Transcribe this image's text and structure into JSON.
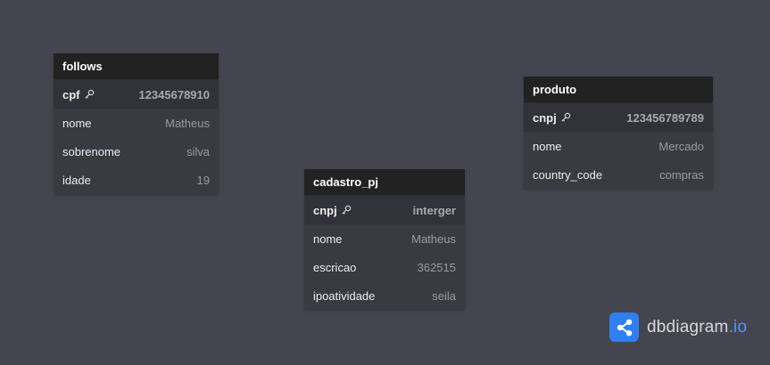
{
  "tables": [
    {
      "name": "follows",
      "fields": [
        {
          "name": "cpf",
          "value": "12345678910",
          "pk": true
        },
        {
          "name": "nome",
          "value": "Matheus",
          "pk": false
        },
        {
          "name": "sobrenome",
          "value": "silva",
          "pk": false
        },
        {
          "name": "idade",
          "value": "19",
          "pk": false
        }
      ]
    },
    {
      "name": "produto",
      "fields": [
        {
          "name": "cnpj",
          "value": "123456789789",
          "pk": true
        },
        {
          "name": "nome",
          "value": "Mercado",
          "pk": false
        },
        {
          "name": "country_code",
          "value": "compras",
          "pk": false
        }
      ]
    },
    {
      "name": "cadastro_pj",
      "fields": [
        {
          "name": "cnpj",
          "value": "interger",
          "pk": true
        },
        {
          "name": "nome",
          "value": "Matheus",
          "pk": false
        },
        {
          "name": "escricao",
          "value": "362515",
          "pk": false
        },
        {
          "name": "ipoatividade",
          "value": "seila",
          "pk": false
        }
      ]
    }
  ],
  "brand": {
    "name": "dbdiagram",
    "suffix": ".io",
    "icon": "share-network-icon",
    "color": "#2f7ff0"
  },
  "colors": {
    "canvas": "#45454f",
    "header": "#222222",
    "row": "#3a3a43",
    "pk_row": "#32323b"
  }
}
